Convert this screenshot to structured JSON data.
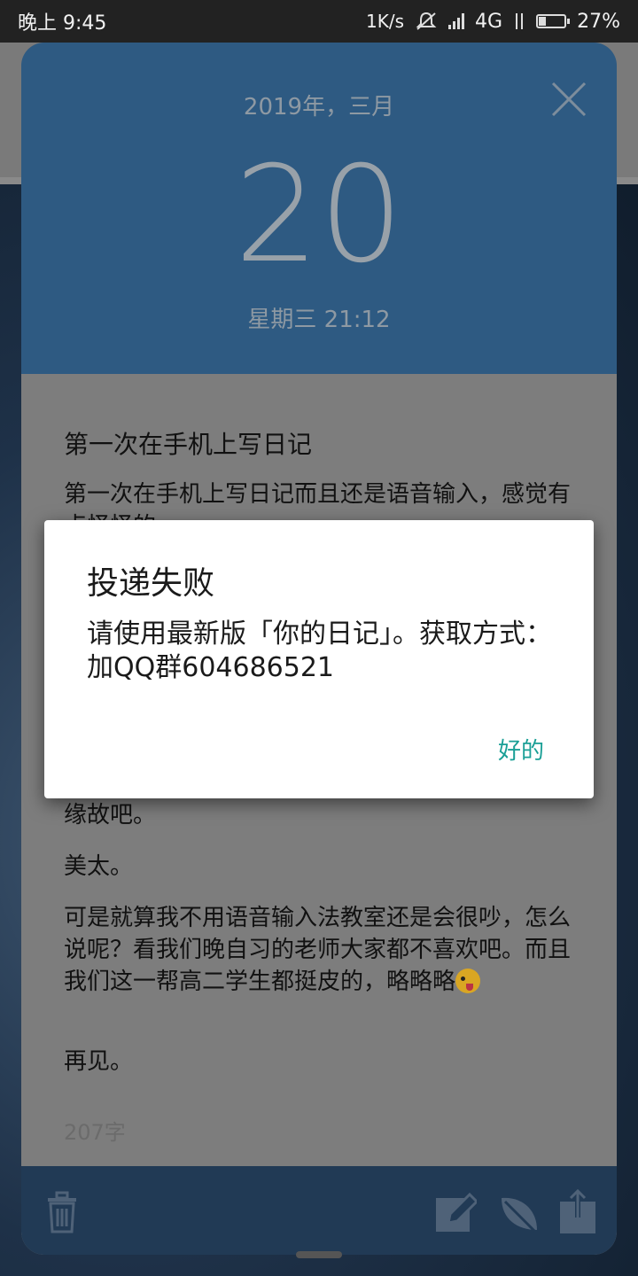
{
  "status_bar": {
    "time": "晚上 9:45",
    "net_speed": "1K/s",
    "network": "4G",
    "battery_percent": "27%",
    "battery_level": 0.27
  },
  "diary": {
    "month": "2019年，三月",
    "day": "20",
    "weekday_time": "星期三 21:12",
    "title": "第一次在手机上写日记",
    "paragraphs": [
      "第一次在手机上写日记而且还是语音输入，感觉有点怪怪的。",
      "缘故吧。",
      "美太。",
      "可是就算我不用语音输入法教室还是会很吵，怎么说呢？看我们晚自习的老师大家都不喜欢吧。而且我们这一帮高二学生都挺皮的，略略略",
      "再见。"
    ],
    "word_count": "207字"
  },
  "dialog": {
    "title": "投递失败",
    "message": "请使用最新版「你的日记」。获取方式：加QQ群604686521",
    "ok_label": "好的"
  },
  "colors": {
    "header": "#2e5a82",
    "footer": "#213a55",
    "accent": "#1a9f96"
  },
  "icons": [
    "close-icon",
    "trash-icon",
    "edit-icon",
    "leaf-icon",
    "share-icon"
  ]
}
